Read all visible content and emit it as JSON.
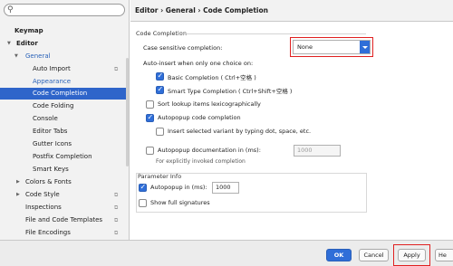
{
  "sidebar": {
    "search": {
      "value": "",
      "placeholder": ""
    },
    "items": [
      {
        "label": "Keymap"
      },
      {
        "label": "Editor"
      },
      {
        "label": "General"
      },
      {
        "label": "Auto Import"
      },
      {
        "label": "Appearance"
      },
      {
        "label": "Code Completion"
      },
      {
        "label": "Code Folding"
      },
      {
        "label": "Console"
      },
      {
        "label": "Editor Tabs"
      },
      {
        "label": "Gutter Icons"
      },
      {
        "label": "Postfix Completion"
      },
      {
        "label": "Smart Keys"
      },
      {
        "label": "Colors & Fonts"
      },
      {
        "label": "Code Style"
      },
      {
        "label": "Inspections"
      },
      {
        "label": "File and Code Templates"
      },
      {
        "label": "File Encodings"
      }
    ]
  },
  "header": {
    "breadcrumb": "Editor › General › Code Completion"
  },
  "content": {
    "section_title": "Code Completion",
    "case_sensitive_label": "Case sensitive completion:",
    "case_sensitive_value": "None",
    "auto_insert_label": "Auto-insert when only one choice on:",
    "basic_completion": {
      "label": "Basic Completion ( Ctrl+空格 )",
      "checked": true
    },
    "smart_completion": {
      "label": "Smart Type Completion ( Ctrl+Shift+空格 )",
      "checked": true
    },
    "sort_lookup": {
      "label": "Sort lookup items lexicographically",
      "checked": false
    },
    "autopopup_code": {
      "label": "Autopopup code completion",
      "checked": true
    },
    "insert_selected": {
      "label": "Insert selected variant by typing dot, space, etc.",
      "checked": false
    },
    "autopopup_doc": {
      "label": "Autopopup documentation in (ms):",
      "checked": false,
      "value": "1000"
    },
    "explicit_hint": "For explicitly invoked completion",
    "param_info_title": "Parameter Info",
    "autopopup_ms": {
      "label": "Autopopup in (ms):",
      "checked": true,
      "value": "1000"
    },
    "show_full_signatures": {
      "label": "Show full signatures",
      "checked": false
    }
  },
  "footer": {
    "ok": "OK",
    "cancel": "Cancel",
    "apply": "Apply",
    "help": "He"
  },
  "colors": {
    "accent": "#2f6ed8",
    "selection": "#2f65ca",
    "highlight_frame": "#e02020"
  }
}
